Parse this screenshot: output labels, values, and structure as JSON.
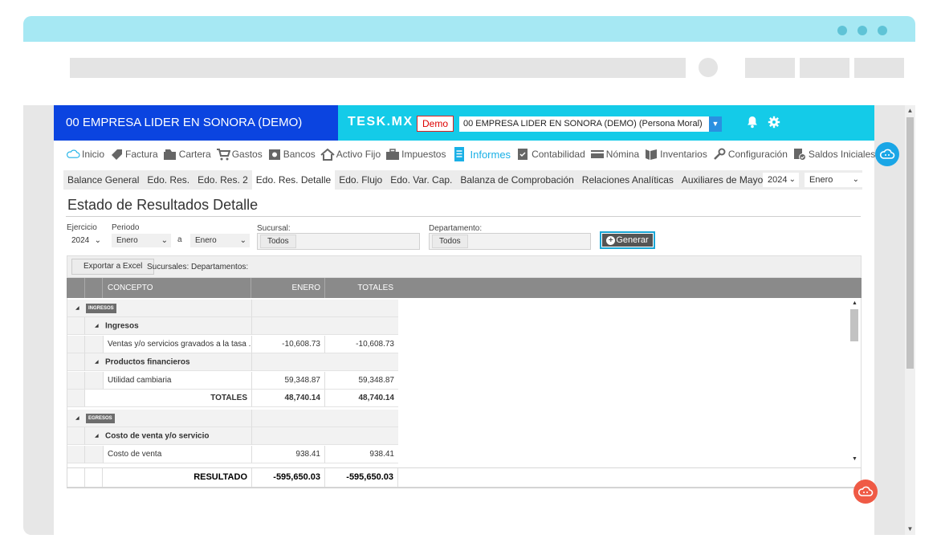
{
  "header": {
    "company_title": "00 EMPRESA LIDER EN SONORA (DEMO)",
    "brand": "TESK.MX",
    "demo_label": "Demo",
    "company_select_value": "00 EMPRESA LIDER EN SONORA (DEMO) (Persona Moral)"
  },
  "nav": {
    "items": [
      {
        "label": "Inicio",
        "icon": "cloud-icon"
      },
      {
        "label": "Factura",
        "icon": "tag-icon"
      },
      {
        "label": "Cartera",
        "icon": "folder-icon"
      },
      {
        "label": "Gastos",
        "icon": "cart-icon"
      },
      {
        "label": "Bancos",
        "icon": "safe-icon"
      },
      {
        "label": "Activo Fijo",
        "icon": "house-icon"
      },
      {
        "label": "Impuestos",
        "icon": "briefcase-icon"
      },
      {
        "label": "Informes",
        "icon": "document-icon",
        "active": true
      },
      {
        "label": "Contabilidad",
        "icon": "ledger-icon"
      },
      {
        "label": "Nómina",
        "icon": "card-icon"
      },
      {
        "label": "Inventarios",
        "icon": "boxes-icon"
      },
      {
        "label": "Configuración",
        "icon": "wrench-icon"
      },
      {
        "label": "Saldos Iniciales",
        "icon": "check-doc-icon"
      }
    ]
  },
  "subnav": {
    "tabs": [
      "Balance General",
      "Edo. Res.",
      "Edo. Res. 2",
      "Edo. Res. Detalle",
      "Edo. Flujo",
      "Edo. Var. Cap.",
      "Balanza de Comprobación",
      "Relaciones Analíticas",
      "Auxiliares de Mayor"
    ],
    "active_index": 3,
    "year": "2024",
    "month": "Enero"
  },
  "page_title": "Estado de Resultados Detalle",
  "filters": {
    "ejercicio_label": "Ejercicio",
    "ejercicio_value": "2024",
    "periodo_label": "Periodo",
    "periodo_from": "Enero",
    "periodo_sep": "a",
    "periodo_to": "Enero",
    "sucursal_label": "Sucursal:",
    "sucursal_value": "Todos",
    "departamento_label": "Departamento:",
    "departamento_value": "Todos",
    "generate_label": "Generar"
  },
  "grid": {
    "export_label": "Exportar a Excel",
    "toolbar_info": "Sucursales: Departamentos:",
    "columns": {
      "concepto": "CONCEPTO",
      "enero": "ENERO",
      "totales": "TOTALES"
    },
    "rows": {
      "ingresos_badge": "INGRESOS",
      "ingresos_group": "Ingresos",
      "ventas_label": "Ventas y/o servicios gravados a la tasa ...",
      "ventas_enero": "-10,608.73",
      "ventas_totales": "-10,608.73",
      "productos_group": "Productos financieros",
      "utilidad_label": "Utilidad cambiaria",
      "utilidad_enero": "59,348.87",
      "utilidad_totales": "59,348.87",
      "totales_label": "TOTALES",
      "totales_enero": "48,740.14",
      "totales_totales": "48,740.14",
      "egresos_badge": "EGRESOS",
      "costo_group": "Costo de venta y/o servicio",
      "costo_label": "Costo de venta",
      "costo_enero": "938.41",
      "costo_totales": "938.41"
    },
    "footer": {
      "label": "RESULTADO",
      "enero": "-595,650.03",
      "totales": "-595,650.03"
    }
  }
}
